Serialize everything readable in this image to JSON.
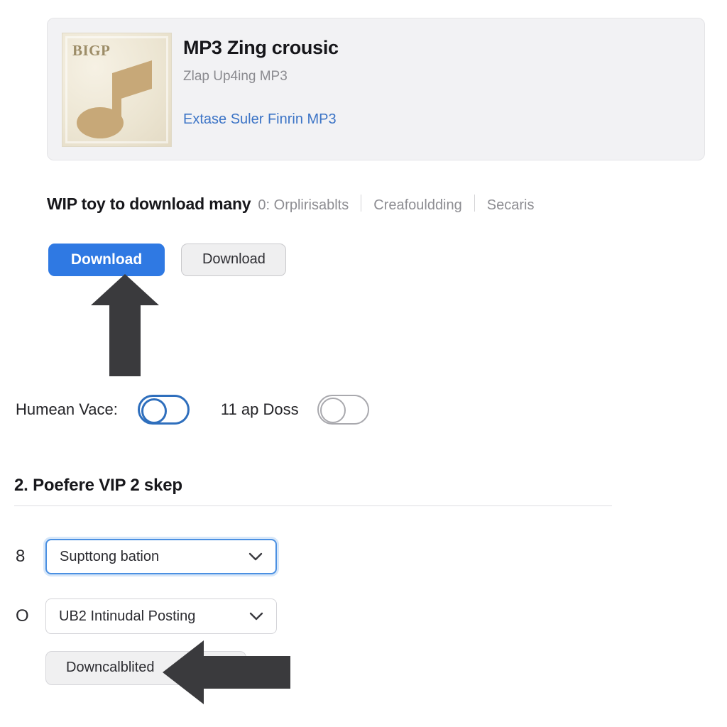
{
  "card": {
    "thumbnail": {
      "badge_text": "BIGP",
      "icon": "music-note-icon",
      "bg_color": "#ece5d2",
      "note_color": "#c7a878"
    },
    "title": "MP3 Zing crousic",
    "subtitle": "Zlap Up4ing MP3",
    "link": "Extase Suler Finrin MP3",
    "bg_color": "#f2f2f4"
  },
  "crumbs": {
    "heading": "WIP toy to download many",
    "items": [
      {
        "label": "0: Orplirisablts"
      },
      {
        "label": "Creafouldding"
      },
      {
        "label": "Secaris"
      }
    ]
  },
  "actions": {
    "primary_label": "Download",
    "secondary_label": "Download",
    "primary_color": "#2f79e3"
  },
  "toggles": [
    {
      "label": "Humean Vace:",
      "state": "off",
      "accent": "#2f6fbd"
    },
    {
      "label": "11 ap Doss",
      "state": "off",
      "accent": "#a9a9ae"
    }
  ],
  "section2": {
    "heading": "2. Poefere VIP 2 skep",
    "fields": [
      {
        "number": "8",
        "value": "Supttong bation",
        "focused": true
      },
      {
        "number": "O",
        "value": "UB2 Intinudal Posting",
        "focused": false
      }
    ],
    "submit_label": "Downcalblited"
  },
  "annotations": {
    "arrow_up": "up-arrow-annotation",
    "arrow_left": "left-arrow-annotation",
    "color": "#3a3a3d"
  }
}
